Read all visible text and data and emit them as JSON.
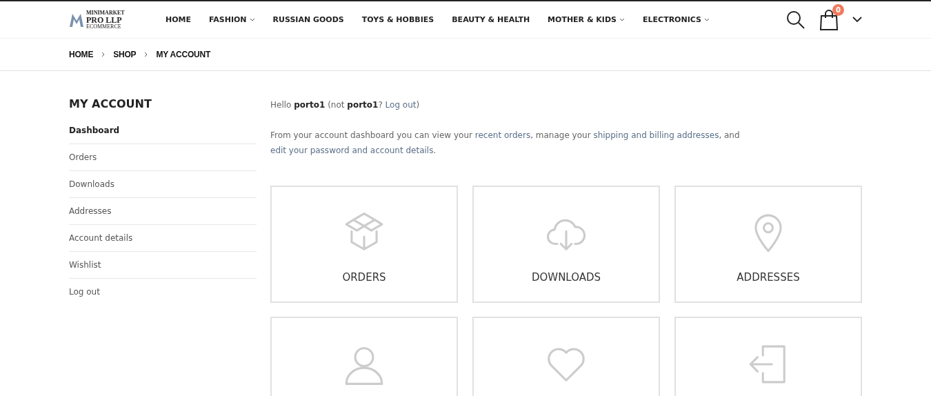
{
  "logo": {
    "line_1": "MINIMARKET",
    "line_2": "PRO LLP",
    "line_3": "ECOMMERCE"
  },
  "nav": [
    {
      "label": "HOME",
      "dropdown": false
    },
    {
      "label": "FASHION",
      "dropdown": true
    },
    {
      "label": "RUSSIAN GOODS",
      "dropdown": false
    },
    {
      "label": "TOYS & HOBBIES",
      "dropdown": false
    },
    {
      "label": "BEAUTY & HEALTH",
      "dropdown": false
    },
    {
      "label": "MOTHER & KIDS",
      "dropdown": true
    },
    {
      "label": "ELECTRONICS",
      "dropdown": true
    }
  ],
  "cart": {
    "count": "0"
  },
  "breadcrumb": [
    "HOME",
    "SHOP",
    "MY ACCOUNT"
  ],
  "sidebar": {
    "title": "MY ACCOUNT",
    "items": [
      {
        "label": "Dashboard",
        "selected": true
      },
      {
        "label": "Orders",
        "selected": false
      },
      {
        "label": "Downloads",
        "selected": false
      },
      {
        "label": "Addresses",
        "selected": false
      },
      {
        "label": "Account details",
        "selected": false
      },
      {
        "label": "Wishlist",
        "selected": false
      },
      {
        "label": "Log out",
        "selected": false
      }
    ]
  },
  "greeting": [
    {
      "kind": "text",
      "text": "Hello "
    },
    {
      "kind": "bold",
      "text": "porto1"
    },
    {
      "kind": "text",
      "text": " (not "
    },
    {
      "kind": "bold",
      "text": "porto1"
    },
    {
      "kind": "text",
      "text": "? "
    },
    {
      "kind": "link",
      "text": "Log out"
    },
    {
      "kind": "text",
      "text": ")"
    }
  ],
  "intro": [
    {
      "kind": "text",
      "text": "From your account dashboard you can view your "
    },
    {
      "kind": "link",
      "text": "recent orders"
    },
    {
      "kind": "text",
      "text": ", manage your "
    },
    {
      "kind": "link",
      "text": "shipping and billing addresses"
    },
    {
      "kind": "text",
      "text": ", and "
    },
    {
      "kind": "link",
      "text": "edit your password and account details"
    },
    {
      "kind": "text",
      "text": "."
    }
  ],
  "cards": [
    {
      "kind": "box",
      "label": "ORDERS"
    },
    {
      "kind": "download",
      "label": "DOWNLOADS"
    },
    {
      "kind": "pin",
      "label": "ADDRESSES"
    },
    {
      "kind": "user"
    },
    {
      "kind": "heart"
    },
    {
      "kind": "logout"
    }
  ]
}
